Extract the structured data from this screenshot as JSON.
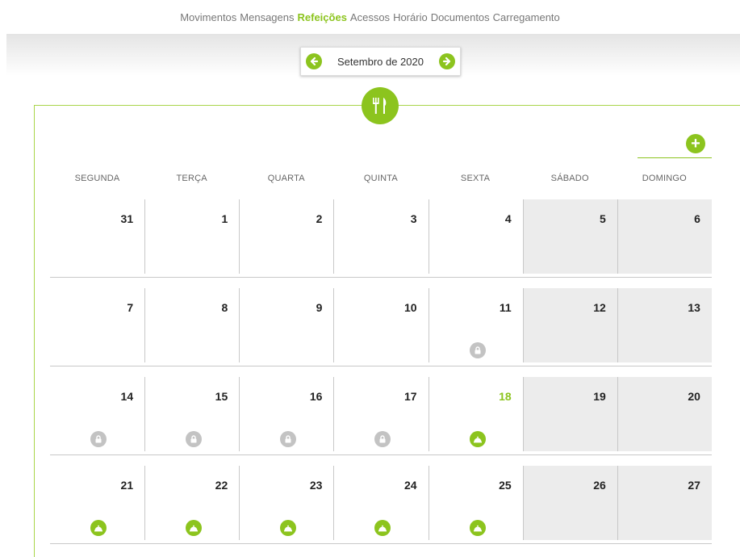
{
  "nav": {
    "items": [
      "Movimentos",
      "Mensagens",
      "Refeições",
      "Acessos",
      "Horário",
      "Documentos",
      "Carregamento"
    ],
    "active_index": 2
  },
  "month": {
    "label": "Setembro de 2020",
    "prev_icon": "arrow-left-icon",
    "next_icon": "arrow-right-icon"
  },
  "section_icon": "cutlery-icon",
  "add_icon": "plus-icon",
  "colors": {
    "accent": "#8cc41e",
    "weekend": "#ececec",
    "lock": "#c3c3c3",
    "frame": "#a9d54a"
  },
  "weekdays": [
    "SEGUNDA",
    "TERÇA",
    "QUARTA",
    "QUINTA",
    "SEXTA",
    "SÁBADO",
    "DOMINGO"
  ],
  "weeks": [
    {
      "days": [
        {
          "n": "31",
          "status": ""
        },
        {
          "n": "1",
          "status": ""
        },
        {
          "n": "2",
          "status": ""
        },
        {
          "n": "3",
          "status": ""
        },
        {
          "n": "4",
          "status": ""
        },
        {
          "n": "5",
          "status": ""
        },
        {
          "n": "6",
          "status": ""
        }
      ]
    },
    {
      "days": [
        {
          "n": "7",
          "status": ""
        },
        {
          "n": "8",
          "status": ""
        },
        {
          "n": "9",
          "status": ""
        },
        {
          "n": "10",
          "status": ""
        },
        {
          "n": "11",
          "status": "locked"
        },
        {
          "n": "12",
          "status": ""
        },
        {
          "n": "13",
          "status": ""
        }
      ]
    },
    {
      "days": [
        {
          "n": "14",
          "status": "locked"
        },
        {
          "n": "15",
          "status": "locked"
        },
        {
          "n": "16",
          "status": "locked"
        },
        {
          "n": "17",
          "status": "locked"
        },
        {
          "n": "18",
          "status": "meal",
          "today": true
        },
        {
          "n": "19",
          "status": ""
        },
        {
          "n": "20",
          "status": ""
        }
      ]
    },
    {
      "days": [
        {
          "n": "21",
          "status": "meal"
        },
        {
          "n": "22",
          "status": "meal"
        },
        {
          "n": "23",
          "status": "meal"
        },
        {
          "n": "24",
          "status": "meal"
        },
        {
          "n": "25",
          "status": "meal"
        },
        {
          "n": "26",
          "status": ""
        },
        {
          "n": "27",
          "status": ""
        }
      ]
    }
  ]
}
